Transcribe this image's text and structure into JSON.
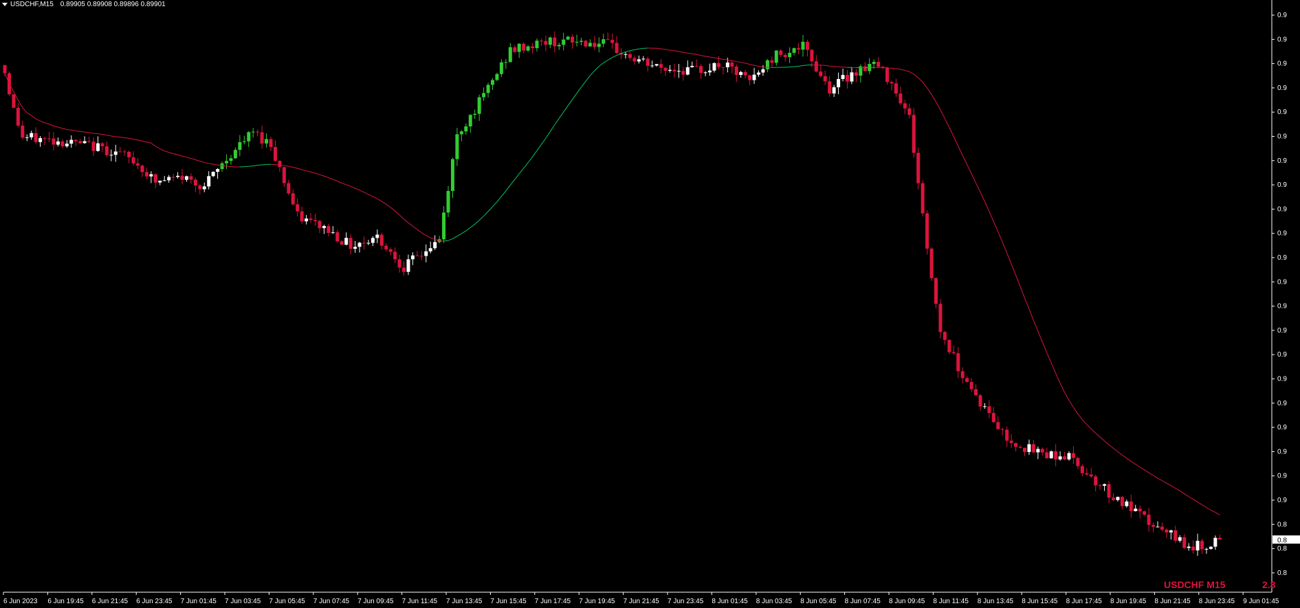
{
  "window": {
    "symbol_title": "USDCHF,M15",
    "ohlc": "0.89905 0.89908 0.89896 0.89901"
  },
  "watermark": {
    "label": "USDCHF M15",
    "value": "2.8"
  },
  "colors": {
    "background": "#000000",
    "bull_above": "#32cd32",
    "bull_below": "#ffffff",
    "bear": "#dc143c",
    "ma_rising": "#00c864",
    "ma_falling": "#dc143c",
    "axis": "#ffffff"
  },
  "chart_data": {
    "type": "candlestick",
    "symbol": "USDCHF",
    "timeframe": "M15",
    "x_tick_labels": [
      "6 Jun 2023",
      "6 Jun 19:45",
      "6 Jun 21:45",
      "6 Jun 23:45",
      "7 Jun 01:45",
      "7 Jun 03:45",
      "7 Jun 05:45",
      "7 Jun 07:45",
      "7 Jun 09:45",
      "7 Jun 11:45",
      "7 Jun 13:45",
      "7 Jun 15:45",
      "7 Jun 17:45",
      "7 Jun 19:45",
      "7 Jun 21:45",
      "7 Jun 23:45",
      "8 Jun 01:45",
      "8 Jun 03:45",
      "8 Jun 05:45",
      "8 Jun 07:45",
      "8 Jun 09:45",
      "8 Jun 11:45",
      "8 Jun 13:45",
      "8 Jun 15:45",
      "8 Jun 17:45",
      "8 Jun 19:45",
      "8 Jun 21:45",
      "8 Jun 23:45",
      "9 Jun 01:45"
    ],
    "y_tick_labels": [
      "0.9",
      "0.9",
      "0.9",
      "0.9",
      "0.9",
      "0.9",
      "0.9",
      "0.9",
      "0.9",
      "0.9",
      "0.9",
      "0.9",
      "0.9",
      "0.9",
      "0.9",
      "0.9",
      "0.9",
      "0.9",
      "0.9",
      "0.9",
      "0.9",
      "0.8",
      "0.8",
      "0.8"
    ],
    "current_price_label": "0.8",
    "close_keypoints": [
      [
        0,
        0.9133
      ],
      [
        2,
        0.9112
      ],
      [
        4,
        0.9097
      ],
      [
        12,
        0.9095
      ],
      [
        20,
        0.9092
      ],
      [
        26,
        0.9088
      ],
      [
        30,
        0.9082
      ],
      [
        34,
        0.9072
      ],
      [
        40,
        0.9075
      ],
      [
        45,
        0.907
      ],
      [
        50,
        0.9085
      ],
      [
        56,
        0.91
      ],
      [
        60,
        0.9093
      ],
      [
        66,
        0.9053
      ],
      [
        72,
        0.9047
      ],
      [
        78,
        0.9037
      ],
      [
        84,
        0.9042
      ],
      [
        90,
        0.9025
      ],
      [
        98,
        0.904
      ],
      [
        102,
        0.9098
      ],
      [
        108,
        0.912
      ],
      [
        114,
        0.9145
      ],
      [
        122,
        0.915
      ],
      [
        130,
        0.915
      ],
      [
        136,
        0.9148
      ],
      [
        142,
        0.914
      ],
      [
        148,
        0.9135
      ],
      [
        156,
        0.9134
      ],
      [
        162,
        0.9137
      ],
      [
        168,
        0.9128
      ],
      [
        174,
        0.9143
      ],
      [
        180,
        0.9147
      ],
      [
        186,
        0.9124
      ],
      [
        192,
        0.9134
      ],
      [
        196,
        0.9138
      ],
      [
        200,
        0.9128
      ],
      [
        204,
        0.9108
      ],
      [
        206,
        0.9072
      ],
      [
        208,
        0.9035
      ],
      [
        211,
        0.899
      ],
      [
        215,
        0.897
      ],
      [
        220,
        0.895
      ],
      [
        226,
        0.893
      ],
      [
        232,
        0.8923
      ],
      [
        240,
        0.892
      ],
      [
        250,
        0.8898
      ],
      [
        260,
        0.888
      ],
      [
        268,
        0.887
      ],
      [
        274,
        0.8873
      ]
    ],
    "candles": [],
    "ma_period": 34
  }
}
